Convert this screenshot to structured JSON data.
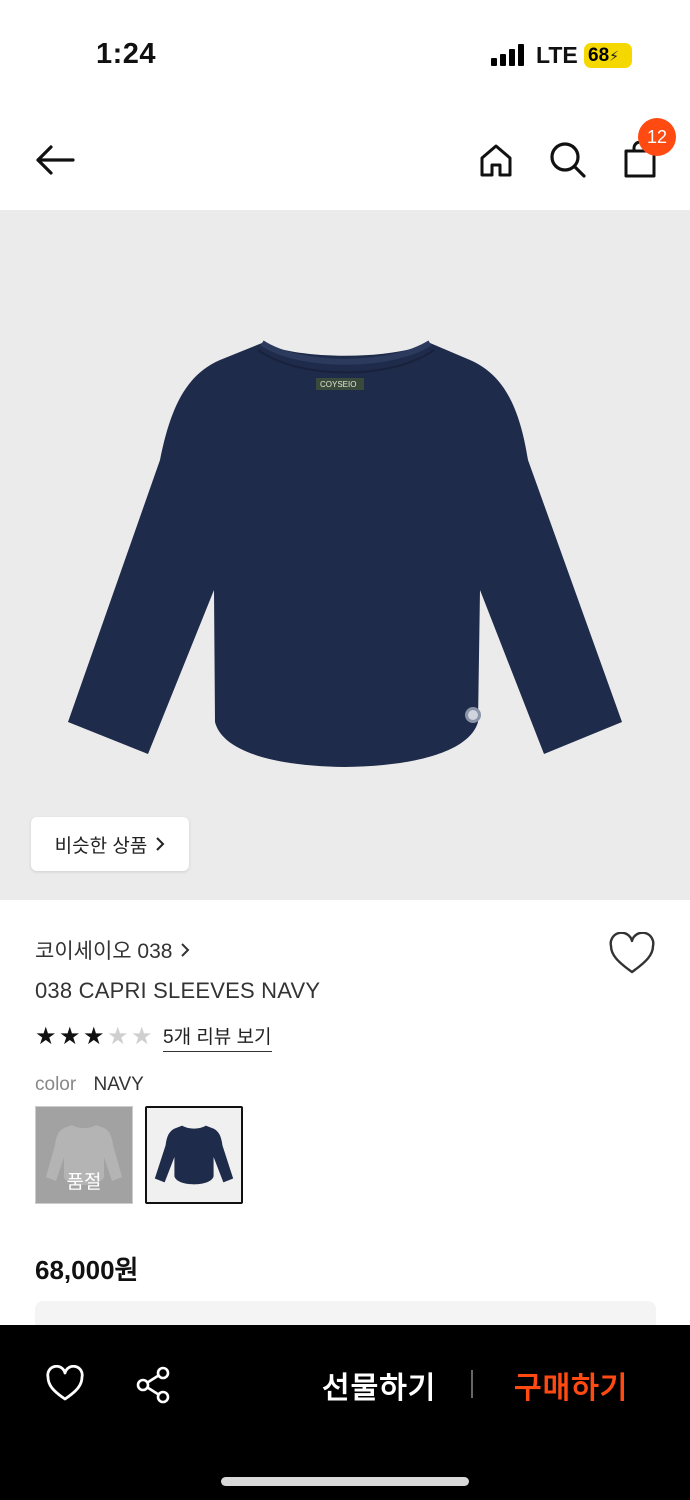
{
  "status": {
    "time": "1:24",
    "network": "LTE",
    "battery": "68"
  },
  "nav": {
    "cart_count": "12"
  },
  "hero": {
    "garment_logo": "COYSEIO",
    "similar_label": "비슷한 상품"
  },
  "product": {
    "brand": "코이세이오 038",
    "name": "038 CAPRI SLEEVES NAVY",
    "rating": 3,
    "rating_max": 5,
    "review_link": "5개 리뷰 보기",
    "color_label": "color",
    "color_value": "NAVY",
    "swatches": [
      {
        "color": "gray",
        "soldout_label": "품절"
      },
      {
        "color": "navy",
        "selected": true
      }
    ],
    "price": "68,000원"
  },
  "bottom_bar": {
    "gift_label": "선물하기",
    "buy_label": "구매하기"
  },
  "colors": {
    "accent": "#ff4a12",
    "navy": "#1f2b4a",
    "hero_bg": "#ebebeb"
  }
}
